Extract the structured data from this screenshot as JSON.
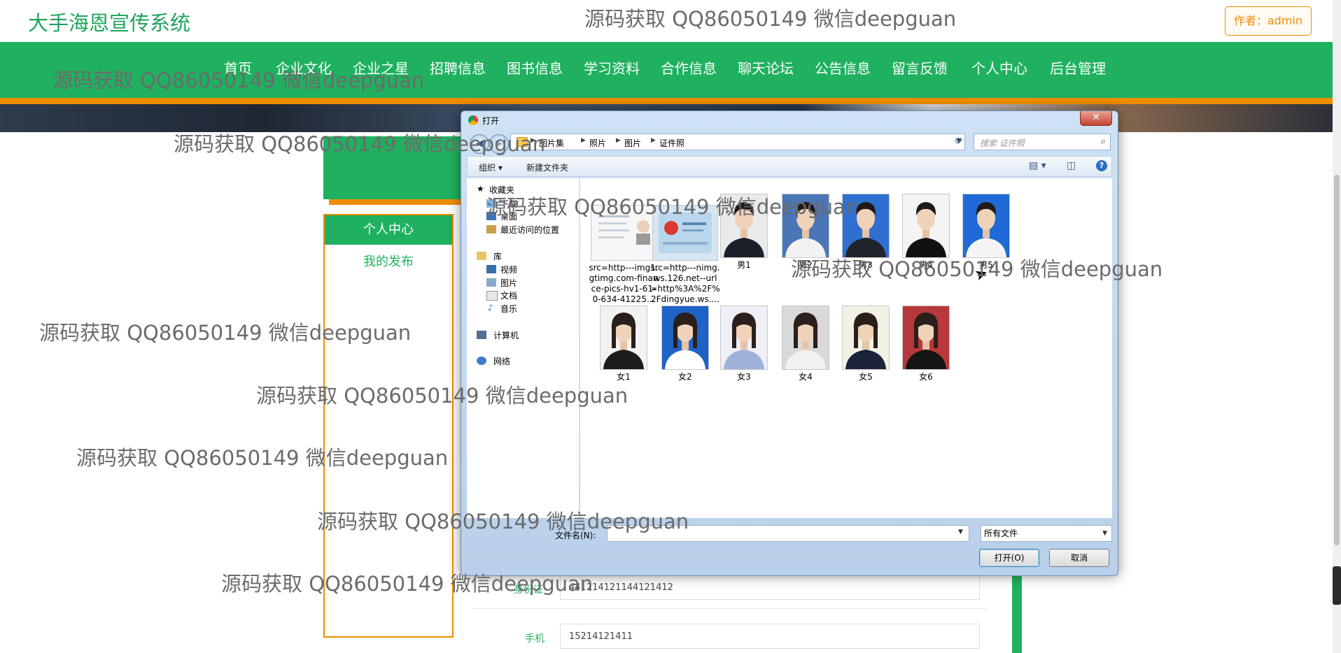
{
  "site": {
    "title": "大手海恩宣传系统",
    "author_badge": "作者：admin"
  },
  "nav": {
    "items": [
      "首页",
      "企业文化",
      "企业之星",
      "招聘信息",
      "图书信息",
      "学习资料",
      "合作信息",
      "聊天论坛",
      "公告信息",
      "留言反馈",
      "个人中心",
      "后台管理"
    ]
  },
  "sidebar": {
    "header": "个人中心",
    "link": "我的发布"
  },
  "form": {
    "id_label": "身份证",
    "id_value": "441214121144121412",
    "phone_label": "手机",
    "phone_value": "15214121411"
  },
  "dialog": {
    "title": "打开",
    "close_glyph": "✕",
    "path": [
      "图片集",
      "照片",
      "图片",
      "证件照"
    ],
    "search_placeholder": "搜索 证件照",
    "toolbar": {
      "organize": "组织 ▾",
      "new_folder": "新建文件夹"
    },
    "nav_pane": {
      "favorites": "收藏夹",
      "downloads": "下载",
      "desktop": "桌面",
      "recent": "最近访问的位置",
      "libraries": "库",
      "videos": "视频",
      "pictures": "图片",
      "documents": "文档",
      "music": "音乐",
      "computer": "计算机",
      "network": "网络"
    },
    "files": [
      {
        "name": "src=http---img1.gtimg.com-finance-pics-hv1-61-0-634-41225...",
        "kind": "doc-card"
      },
      {
        "name": "src=http---nimg.ws.126.net--url=http%3A%2F%2Fdingyue.ws....",
        "kind": "id-card"
      },
      {
        "name": "男1",
        "kind": "male",
        "bg": "#e9eaec",
        "shirt": "#1b1f2a"
      },
      {
        "name": "男2",
        "kind": "male",
        "bg": "#4a76b8",
        "shirt": "#f2f2f2"
      },
      {
        "name": "男3",
        "kind": "male",
        "bg": "#2f6fd1",
        "shirt": "#20242c"
      },
      {
        "name": "男4",
        "kind": "male",
        "bg": "#f4f4f4",
        "shirt": "#111111"
      },
      {
        "name": "男5",
        "kind": "male",
        "bg": "#1f6ad6",
        "shirt": "#f5f5f5"
      },
      {
        "name": "女1",
        "kind": "female",
        "bg": "#f2f2f2",
        "shirt": "#1c1c1c"
      },
      {
        "name": "女2",
        "kind": "female",
        "bg": "#1f63c9",
        "shirt": "#ffffff"
      },
      {
        "name": "女3",
        "kind": "female",
        "bg": "#eef0f6",
        "shirt": "#9fb1d9"
      },
      {
        "name": "女4",
        "kind": "female",
        "bg": "#d9d9d9",
        "shirt": "#f1f1f1"
      },
      {
        "name": "女5",
        "kind": "female",
        "bg": "#f3f1e6",
        "shirt": "#1a2338"
      },
      {
        "name": "女6",
        "kind": "female",
        "bg": "#b8383b",
        "shirt": "#151515"
      }
    ],
    "filename_label": "文件名(N):",
    "filename_value": "",
    "filter_value": "所有文件",
    "open_button": "打开(O)",
    "cancel_button": "取消"
  },
  "watermark": "源码获取 QQ86050149 微信deepguan",
  "colors": {
    "brand_green": "#1fb15f",
    "accent_orange": "#f08c00"
  }
}
